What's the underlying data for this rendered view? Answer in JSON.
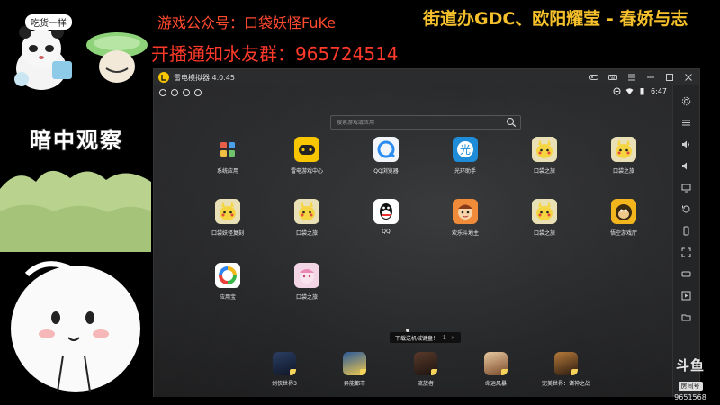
{
  "overlay": {
    "bear_caption": "吃货一样",
    "peek_text": "暗中观察",
    "promo_line_1": "游戏公众号：口袋妖怪FuKe",
    "promo_line_2": "开播通知水友群：965724514",
    "marquee": "街道办GDC、欧阳耀莹 - 春娇与志"
  },
  "emulator": {
    "title": "雷电模拟器 4.0.45",
    "controls": [
      "gamepad-icon",
      "keyboard-icon",
      "menu-icon",
      "minimize-icon",
      "maximize-icon",
      "close-icon"
    ],
    "status": {
      "time": "6:47"
    },
    "search": {
      "placeholder": "搜索游戏或应用"
    },
    "apps_row1": [
      {
        "label": "系统应用",
        "icon": "system-apps-icon"
      },
      {
        "label": "雷电游戏中心",
        "icon": "ld-gamecenter-icon"
      },
      {
        "label": "QQ浏览器",
        "icon": "qq-browser-icon"
      },
      {
        "label": "光环助手",
        "icon": "halo-helper-icon"
      },
      {
        "label": "口袋之旅",
        "icon": "pokemon-icon"
      },
      {
        "label": "口袋之旅",
        "icon": "pokemon-icon"
      }
    ],
    "apps_row2": [
      {
        "label": "口袋妖怪复刻",
        "icon": "pokemon-icon"
      },
      {
        "label": "口袋之旅",
        "icon": "pokemon-icon"
      },
      {
        "label": "QQ",
        "icon": "qq-icon"
      },
      {
        "label": "欢乐斗地主",
        "icon": "doudizhu-icon"
      },
      {
        "label": "口袋之旅",
        "icon": "pokemon-icon"
      },
      {
        "label": "悟空游戏厅",
        "icon": "wukong-icon"
      }
    ],
    "apps_row3": [
      {
        "label": "应用宝",
        "icon": "yingyongbao-icon"
      },
      {
        "label": "口袋之旅",
        "icon": "pokemon-icon"
      }
    ],
    "toast": {
      "text": "下载送机械键盘！",
      "action": "1",
      "close": "×"
    },
    "dock": [
      {
        "label": "剑侠世界3"
      },
      {
        "label": "异能都市"
      },
      {
        "label": "流放者"
      },
      {
        "label": "命运风暴"
      },
      {
        "label": "完美世界：诸神之战"
      }
    ],
    "toolbar": [
      "gear-icon",
      "more-icon",
      "volume-up-icon",
      "volume-down-icon",
      "screen-icon",
      "rotate-icon",
      "shake-icon",
      "fullscreen-icon",
      "keymap-icon",
      "play-icon",
      "folder-icon"
    ]
  },
  "douyu": {
    "mark": "斗鱼",
    "sub": "房间号",
    "room": "9651568"
  }
}
